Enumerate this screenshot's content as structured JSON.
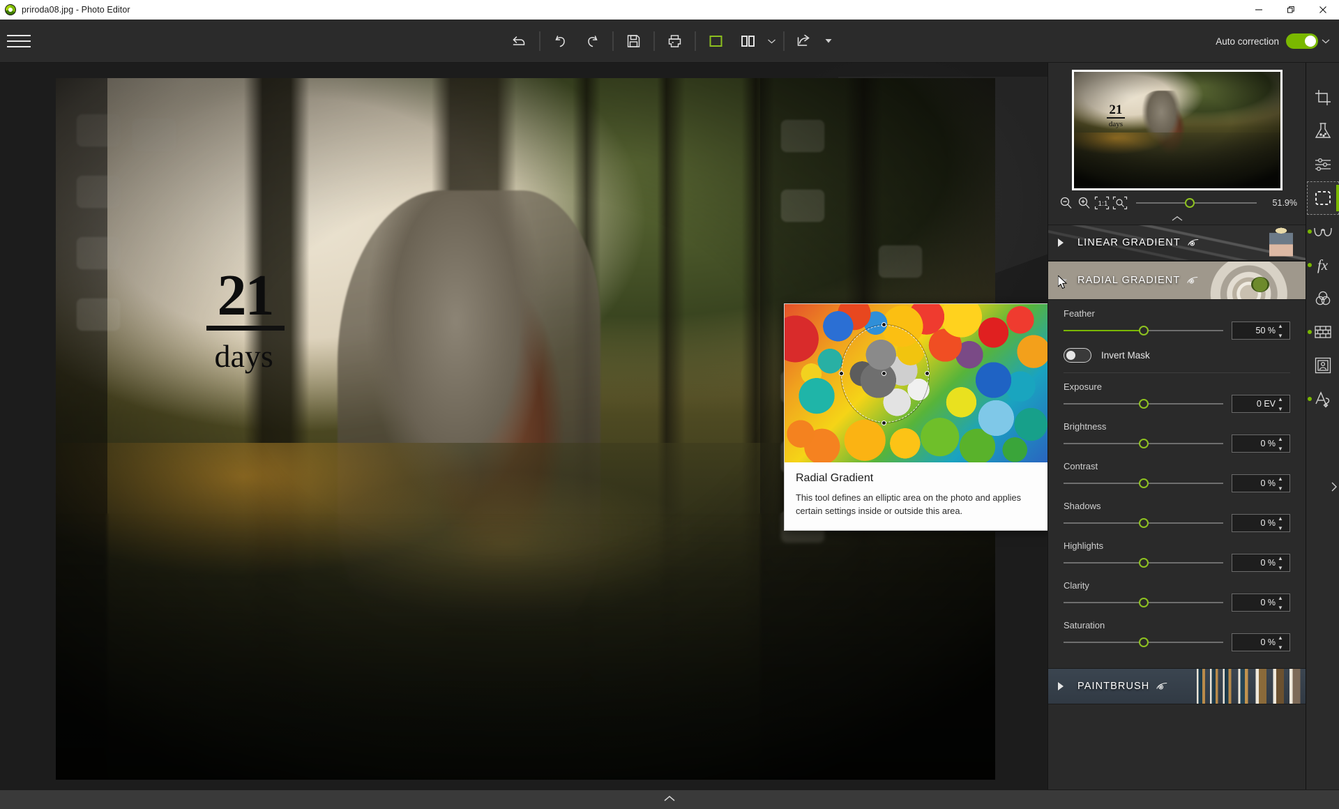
{
  "window": {
    "title": "priroda08.jpg - Photo Editor",
    "logo_icon": "app-logo-icon",
    "controls": {
      "minimize": "–",
      "maximize": "❐",
      "close": "✕"
    }
  },
  "toolbar": {
    "menu_icon": "hamburger-menu-icon",
    "buttons": [
      {
        "name": "revert-all",
        "icon": "undo-all-icon",
        "label": "Revert"
      },
      {
        "name": "undo",
        "icon": "undo-icon",
        "label": "Undo"
      },
      {
        "name": "redo",
        "icon": "redo-icon",
        "label": "Redo"
      },
      {
        "name": "save",
        "icon": "save-floppy-icon",
        "label": "Save"
      },
      {
        "name": "print",
        "icon": "printer-icon",
        "label": "Print"
      },
      {
        "name": "single-view",
        "icon": "single-pane-icon",
        "label": "Single view"
      },
      {
        "name": "split-view",
        "icon": "split-pane-icon",
        "label": "Split view"
      },
      {
        "name": "share",
        "icon": "share-arrow-icon",
        "label": "Share"
      }
    ],
    "auto_correction_label": "Auto correction",
    "auto_correction_state": "on",
    "auto_correction_caret": "chevron-down-icon"
  },
  "photo": {
    "overlay_number": "21",
    "overlay_word": "days"
  },
  "navigator": {
    "thumbnail_name": "navigator-thumbnail",
    "zoom_out_icon": "zoom-out-icon",
    "zoom_in_icon": "zoom-in-icon",
    "actual_size_icon": "zoom-1-to-1-icon",
    "fit_screen_icon": "zoom-fit-icon",
    "zoom_value": "51.9%",
    "zoom_slider_pct": 40.5,
    "collapse_icon": "chevron-up-icon"
  },
  "sections": [
    {
      "name": "linear-gradient",
      "label": "LINEAR GRADIENT",
      "eye_icon": "eye-icon",
      "expanded": false
    },
    {
      "name": "radial-gradient",
      "label": "RADIAL GRADIENT",
      "eye_icon": "eye-icon",
      "expanded": true
    },
    {
      "name": "paintbrush",
      "label": "PAINTBRUSH",
      "eye_icon": "eye-icon",
      "expanded": false
    }
  ],
  "radial_gradient_controls": {
    "feather": {
      "label": "Feather",
      "value": "50 %",
      "slider_pct": 50,
      "filled": true
    },
    "invert_mask": {
      "label": "Invert Mask",
      "state": "off"
    },
    "adjustments": [
      {
        "label": "Exposure",
        "value": "0 EV",
        "slider_pct": 50
      },
      {
        "label": "Brightness",
        "value": "0 %",
        "slider_pct": 50
      },
      {
        "label": "Contrast",
        "value": "0 %",
        "slider_pct": 50
      },
      {
        "label": "Shadows",
        "value": "0 %",
        "slider_pct": 50
      },
      {
        "label": "Highlights",
        "value": "0 %",
        "slider_pct": 50
      },
      {
        "label": "Clarity",
        "value": "0 %",
        "slider_pct": 50
      },
      {
        "label": "Saturation",
        "value": "0 %",
        "slider_pct": 50
      }
    ]
  },
  "tooltip": {
    "title": "Radial Gradient",
    "description": "This tool defines an elliptic area on the photo and applies certain settings inside or outside this area.",
    "preview_name": "radial-gradient-preview-image"
  },
  "tool_rail": [
    {
      "name": "crop",
      "icon": "crop-icon",
      "active": false,
      "has_dot": false
    },
    {
      "name": "retouch",
      "icon": "flask-icon",
      "active": false,
      "has_dot": false
    },
    {
      "name": "adjust",
      "icon": "sliders-icon",
      "active": false,
      "has_dot": false
    },
    {
      "name": "selection",
      "icon": "marquee-select-icon",
      "active": true,
      "has_dot": false
    },
    {
      "name": "denoise",
      "icon": "glasses-icon",
      "active": false,
      "has_dot": true
    },
    {
      "name": "effects",
      "icon": "fx-icon",
      "active": false,
      "has_dot": true
    },
    {
      "name": "color-mix",
      "icon": "color-circles-icon",
      "active": false,
      "has_dot": false
    },
    {
      "name": "texture",
      "icon": "brick-wall-icon",
      "active": false,
      "has_dot": true
    },
    {
      "name": "frame",
      "icon": "frame-portrait-icon",
      "active": false,
      "has_dot": false
    },
    {
      "name": "text",
      "icon": "text-a-icon",
      "active": false,
      "has_dot": true
    }
  ],
  "rail_expand_icon": "chevron-right-icon",
  "bottombar": {
    "collapse_icon": "chevron-up-icon"
  },
  "colors": {
    "accent_green": "#7ab800",
    "knob_green": "#8ec220",
    "panel_bg": "#2a2a2a",
    "toolbar_bg": "#2b2b2b",
    "canvas_bg": "#1c1c1c",
    "titlebar_bg": "#ffffff"
  }
}
